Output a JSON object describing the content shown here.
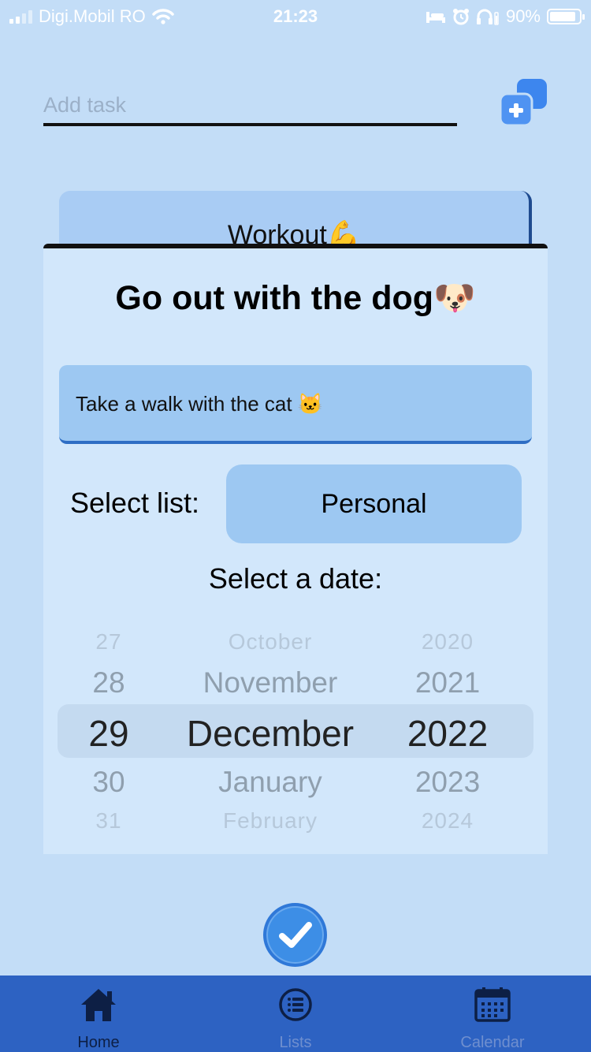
{
  "status_bar": {
    "carrier": "Digi.Mobil RO",
    "time": "21:23",
    "battery": "90%",
    "battery_level": 0.9
  },
  "add_task": {
    "placeholder": "Add task",
    "button_icon": "add-copy-icon"
  },
  "background_card": {
    "title": "Workout💪"
  },
  "modal": {
    "title": "Go out with the dog🐶",
    "description": "Take a walk with the cat 🐱",
    "select_list_label": "Select list:",
    "selected_list": "Personal",
    "select_date_label": "Select a date:",
    "date_picker": {
      "days": [
        "27",
        "28",
        "29",
        "30",
        "31"
      ],
      "months": [
        "October",
        "November",
        "December",
        "January",
        "February"
      ],
      "years": [
        "2020",
        "2021",
        "2022",
        "2023",
        "2024"
      ],
      "selected": {
        "day": "29",
        "month": "December",
        "year": "2022"
      }
    }
  },
  "confirm_icon": "checkmark-icon",
  "tabs": [
    {
      "label": "Home",
      "icon": "home-icon",
      "active": true
    },
    {
      "label": "Lists",
      "icon": "list-icon",
      "active": false
    },
    {
      "label": "Calendar",
      "icon": "calendar-icon",
      "active": false
    }
  ],
  "colors": {
    "background": "#c3ddf7",
    "modal": "#d2e7fb",
    "accent": "#3d8ee6",
    "tab_bar": "#2d62c2"
  }
}
